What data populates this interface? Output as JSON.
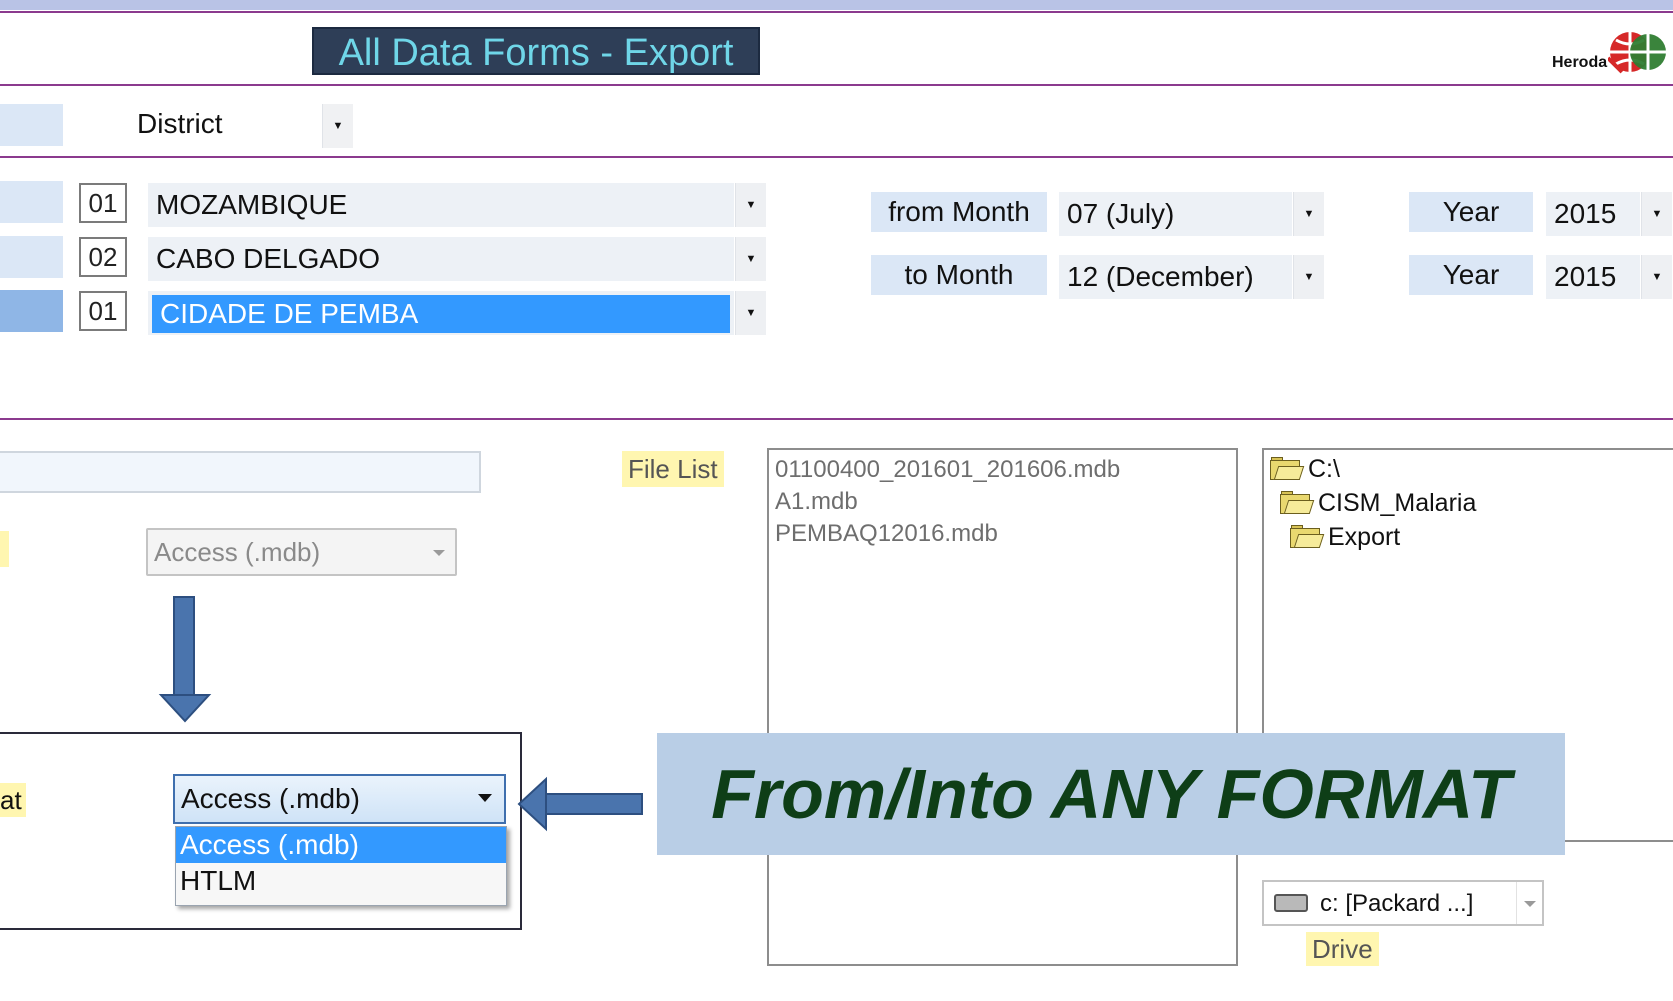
{
  "header": {
    "title": "All Data Forms - Export",
    "logo_text": "Heroda"
  },
  "filters": {
    "level_label": "District",
    "rows": [
      {
        "code": "01",
        "value": "MOZAMBIQUE",
        "selected": false
      },
      {
        "code": "02",
        "value": "CABO DELGADO",
        "selected": false
      },
      {
        "code": "01",
        "value": "CIDADE DE PEMBA",
        "selected": true
      }
    ]
  },
  "period": {
    "from_label": "from Month",
    "from_month": "07  (July)",
    "from_year_label": "Year",
    "from_year": "2015",
    "to_label": "to Month",
    "to_month": "12  (December)",
    "to_year_label": "Year",
    "to_year": "2015"
  },
  "export": {
    "source_format": "Access (.mdb)",
    "target_format_label_fragment": "at",
    "target_format": "Access (.mdb)",
    "format_options": [
      "Access (.mdb)",
      "HTLM"
    ]
  },
  "files": {
    "label": "File List",
    "items": [
      "01100400_201601_201606.mdb",
      "A1.mdb",
      "PEMBAQ12016.mdb"
    ]
  },
  "directories": {
    "items": [
      "C:\\",
      "CISM_Malaria",
      "Export"
    ]
  },
  "drive": {
    "value": "c: [Packard ...]",
    "label": "Drive"
  },
  "banner": {
    "text": "From/Into ANY FORMAT"
  },
  "colors": {
    "divider": "#8b3a8e",
    "selection": "#3399ff",
    "label_bg": "#dbe7f6",
    "highlight": "#fff6b0",
    "banner_bg": "#b9cee6",
    "banner_text": "#0e3e17",
    "arrow": "#4a74ad"
  }
}
